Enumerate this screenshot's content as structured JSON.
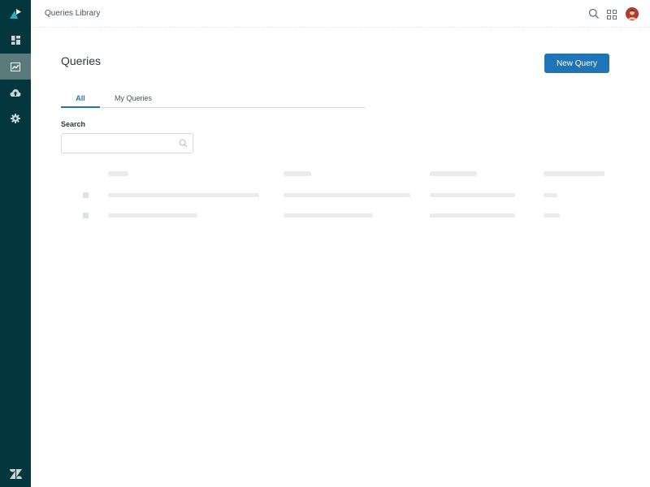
{
  "header": {
    "title": "Queries Library"
  },
  "sidebar": {
    "items": [
      {
        "name": "dashboard",
        "icon": "dashboard-icon"
      },
      {
        "name": "queries",
        "icon": "line-chart-icon",
        "active": true
      },
      {
        "name": "upload",
        "icon": "cloud-upload-icon"
      },
      {
        "name": "settings",
        "icon": "gear-icon"
      }
    ]
  },
  "main": {
    "title": "Queries",
    "new_query_label": "New Query",
    "tabs": [
      {
        "label": "All",
        "active": true
      },
      {
        "label": "My Queries",
        "active": false
      }
    ],
    "search": {
      "label": "Search",
      "value": "",
      "placeholder": ""
    }
  },
  "colors": {
    "sidebar_bg": "#03363d",
    "sidebar_active": "#5b7a7c",
    "accent": "#1f73b7",
    "avatar": "#b53a2e"
  }
}
